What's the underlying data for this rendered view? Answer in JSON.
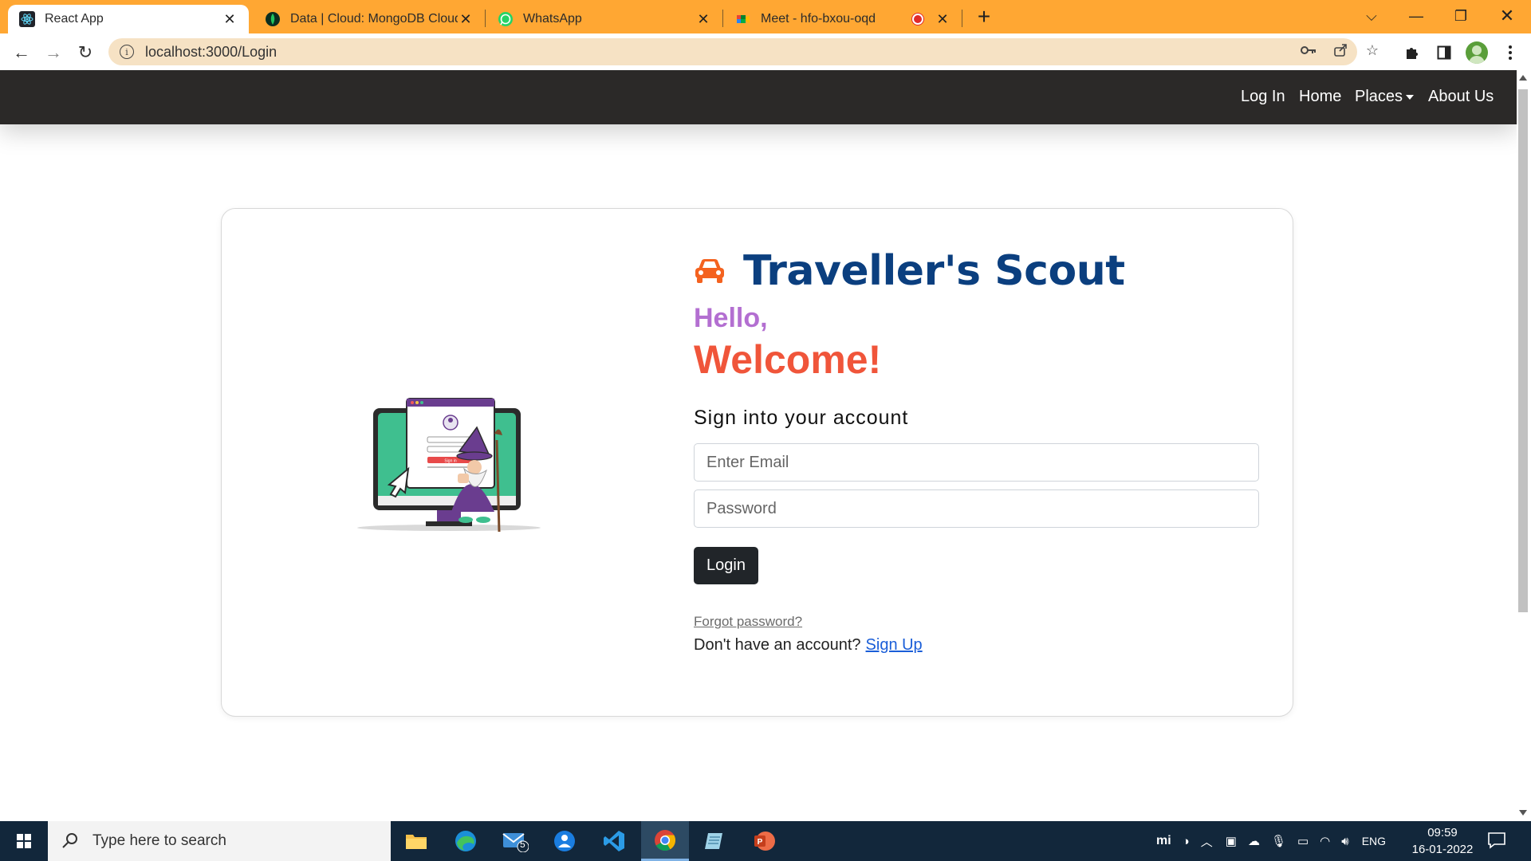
{
  "browser": {
    "tabs": [
      {
        "title": "React App",
        "active": true
      },
      {
        "title": "Data | Cloud: MongoDB Cloud",
        "active": false
      },
      {
        "title": "WhatsApp",
        "active": false
      },
      {
        "title": "Meet - hfo-bxou-oqd",
        "active": false
      }
    ],
    "url": "localhost:3000/Login"
  },
  "nav": {
    "links": [
      "Log In",
      "Home",
      "Places",
      "About Us"
    ]
  },
  "login": {
    "brand": "Traveller's Scout",
    "hello": "Hello,",
    "welcome": "Welcome!",
    "subtitle": "Sign into your account",
    "email_placeholder": "Enter Email",
    "password_placeholder": "Password",
    "login_button": "Login",
    "forgot": "Forgot password?",
    "no_account": "Don't have an account?",
    "signup": "Sign Up"
  },
  "illustration_text": {
    "button": "Sign in"
  },
  "taskbar": {
    "search_placeholder": "Type here to search",
    "mail_badge": "5",
    "lang": "ENG",
    "time": "09:59",
    "date": "16-01-2022"
  },
  "colors": {
    "tabstrip": "#ffa733",
    "brand": "#0b3f7f",
    "hello": "#b36fd1",
    "welcome": "#f0553a",
    "navbar": "#2b2928"
  }
}
